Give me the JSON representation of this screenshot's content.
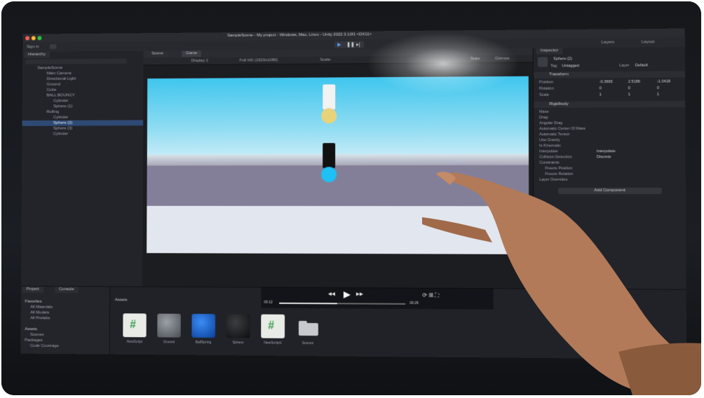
{
  "window": {
    "title": "SampleScene - My project - Windows, Mac, Linux - Unity 2022.3.10f1 <DX11>"
  },
  "toolbar": {
    "account_label": "Sign in",
    "play_icon": "play-icon",
    "pause_icon": "pause-icon",
    "step_icon": "step-icon",
    "layers_label": "Layers",
    "layout_label": "Layout"
  },
  "hierarchy": {
    "tab_label": "Hierarchy",
    "items": [
      {
        "label": "SampleScene"
      },
      {
        "label": "Main Camera"
      },
      {
        "label": "Directional Light"
      },
      {
        "label": "Ground"
      },
      {
        "label": "Cube"
      },
      {
        "label": "BALL BOUNCY"
      },
      {
        "label": "Cylinder"
      },
      {
        "label": "Sphere (1)"
      },
      {
        "label": "Rolling"
      },
      {
        "label": "Cylinder"
      },
      {
        "label": "Sphere (2)"
      },
      {
        "label": "Sphere (3)"
      },
      {
        "label": "Cylinder"
      }
    ]
  },
  "scene": {
    "tabs": [
      {
        "label": "Scene"
      },
      {
        "label": "Game"
      }
    ],
    "display_label": "Display 1",
    "aspect_label": "Full HD (1920x1080)",
    "scale_label": "Scale",
    "stats_label": "Stats",
    "gizmos_label": "Gizmos"
  },
  "inspector": {
    "tab_label": "Inspector",
    "object_name": "Sphere (2)",
    "tag_label": "Tag",
    "tag_value": "Untagged",
    "layer_label": "Layer",
    "layer_value": "Default",
    "transform_header": "Transform",
    "transform_rows": [
      {
        "label": "Position",
        "x": "-0.3665",
        "y": "2.5186",
        "z": "-1.0418"
      },
      {
        "label": "Rotation",
        "x": "0",
        "y": "0",
        "z": "0"
      },
      {
        "label": "Scale",
        "x": "1",
        "y": "1",
        "z": "1"
      }
    ],
    "rigidbody_header": "Rigidbody",
    "rigidbody_rows": [
      {
        "label": "Mass"
      },
      {
        "label": "Drag"
      },
      {
        "label": "Angular Drag"
      },
      {
        "label": "Automatic Center Of Mass"
      },
      {
        "label": "Automatic Tensor"
      },
      {
        "label": "Use Gravity"
      },
      {
        "label": "Is Kinematic"
      },
      {
        "label": "Interpolate",
        "value": "Interpolate"
      },
      {
        "label": "Collision Detection",
        "value": "Discrete"
      },
      {
        "label": "Constraints"
      },
      {
        "label": "Freeze Position"
      },
      {
        "label": "Freeze Rotation"
      },
      {
        "label": "Layer Overrides"
      }
    ],
    "add_component_label": "Add Component"
  },
  "project": {
    "tabs": [
      {
        "label": "Project"
      },
      {
        "label": "Console"
      }
    ],
    "favorites_label": "Favorites",
    "favorite_items": [
      {
        "label": "All Materials"
      },
      {
        "label": "All Models"
      },
      {
        "label": "All Prefabs"
      }
    ],
    "assets_label": "Assets",
    "tree_items": [
      {
        "label": "Assets"
      },
      {
        "label": "Scenes"
      },
      {
        "label": "Packages"
      },
      {
        "label": "Code Coverage"
      }
    ],
    "breadcrumb": "Assets",
    "assets": [
      {
        "label": "NewScript",
        "icon": "csharp-script-icon"
      },
      {
        "label": "Ground",
        "icon": "material-sphere-icon"
      },
      {
        "label": "BallSpring",
        "icon": "material-sphere-icon"
      },
      {
        "label": "Sphere",
        "icon": "material-sphere-icon"
      },
      {
        "label": "NewScript1",
        "icon": "csharp-script-icon"
      },
      {
        "label": "Scenes",
        "icon": "folder-icon"
      }
    ]
  },
  "video_overlay": {
    "current_time": "00:12",
    "total_time": "00:26",
    "progress": 0.46
  },
  "colors": {
    "sky": "#3fc6ee",
    "ground": "#837f99",
    "floor": "#e2e6ee",
    "capsule_white": "#f2f2f2",
    "ball_yellow": "#e8d37a",
    "capsule_black": "#111111",
    "ball_blue": "#1ec0f5",
    "selection": "#2e4a74"
  }
}
